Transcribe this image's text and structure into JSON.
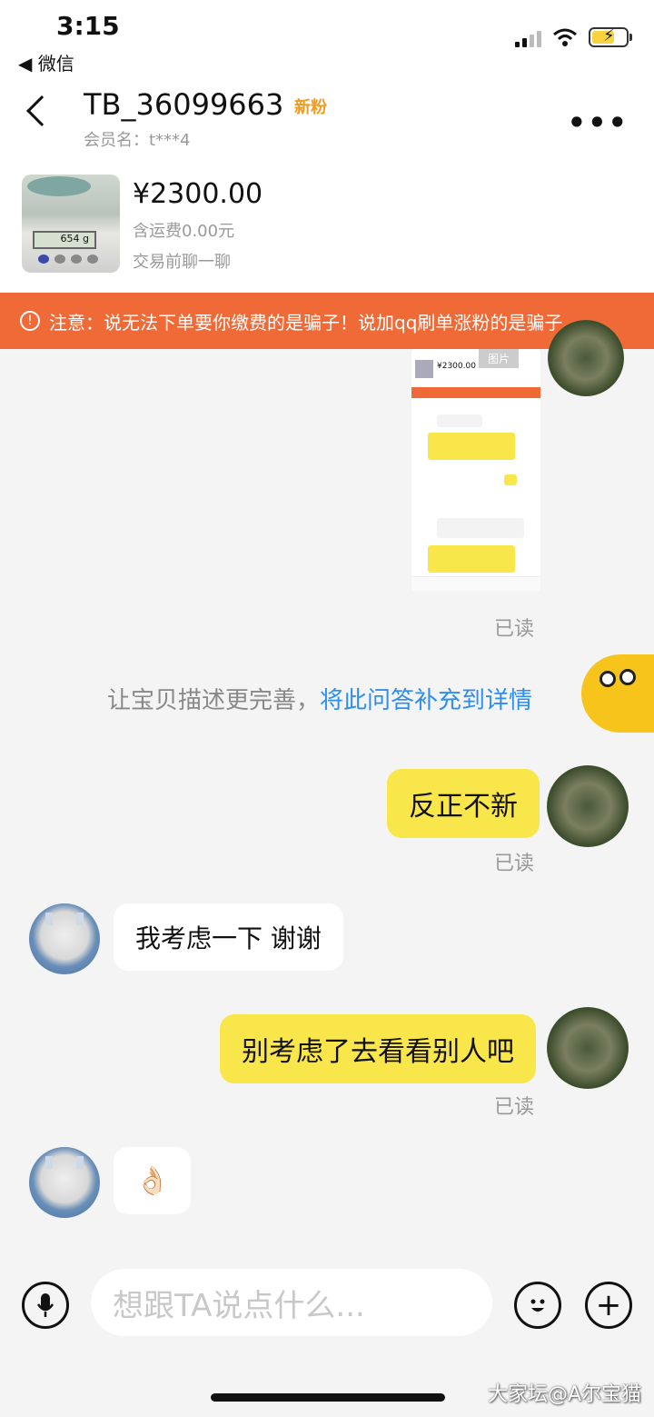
{
  "status_bar": {
    "time": "3:15",
    "back_app": "◀ 微信"
  },
  "header": {
    "title": "TB_36099663",
    "badge": "新粉",
    "member_label": "会员名：t***4",
    "more": "•••"
  },
  "product": {
    "price": "¥2300.00",
    "shipping": "含运费0.00元",
    "note": "交易前聊一聊",
    "scale_reading": "654 g"
  },
  "notice": {
    "text": "注意：说无法下单要你缴费的是骗子！说加qq刷单涨粉的是骗子"
  },
  "image_message": {
    "tag": "图片",
    "mini_price": "¥2300.00"
  },
  "suggestion": {
    "text": "让宝贝描述更完善，",
    "link": "将此问答补充到详情"
  },
  "messages": [
    {
      "from": "me",
      "text": "反正不新",
      "status": "已读"
    },
    {
      "from": "other",
      "text": "我考虑一下  谢谢"
    },
    {
      "from": "me",
      "text": "别考虑了去看看别人吧",
      "status": "已读"
    },
    {
      "from": "other",
      "text": "👌🏻"
    }
  ],
  "image_status": "已读",
  "input": {
    "placeholder": "想跟TA说点什么..."
  },
  "watermark": "大家坛@A尔宝猫",
  "colors": {
    "accent_yellow": "#f9e64b",
    "notice_orange": "#ef6a36",
    "link_blue": "#2e8df0",
    "badge_orange": "#f29a1d"
  }
}
